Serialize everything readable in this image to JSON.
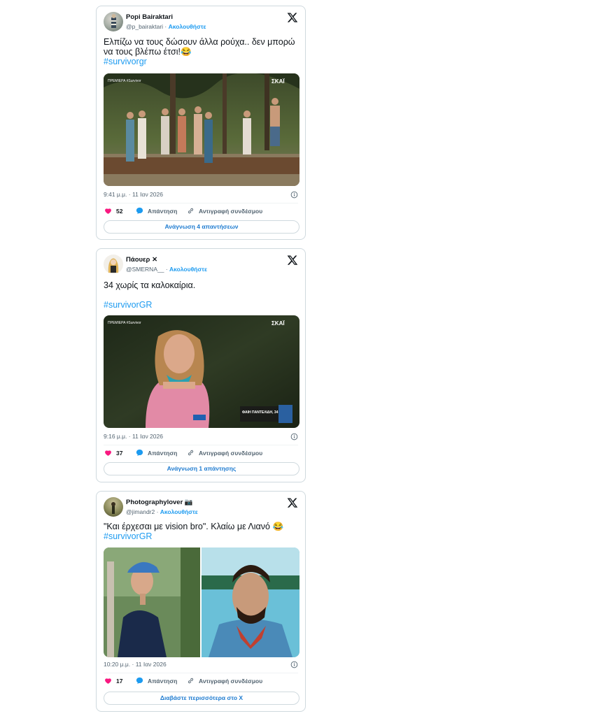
{
  "tweets": [
    {
      "name": "Popi Bairaktari",
      "handle": "@p_bairaktari",
      "follow": "Ακολουθήστε",
      "text_line1": "Ελπίζω να τους δώσουν άλλα ρούχα.. δεν μπορώ",
      "text_line2": "να τους βλέπω έτσι!😂",
      "hashtag": "#survivorgr",
      "media_logo": "ΣΚΑΪ",
      "media_caption": "ΠΡΕΜΙΕΡΑ #Survivor",
      "time": "9:41 μ.μ. · 11 Ιαν 2026",
      "likes": "52",
      "reply": "Απάντηση",
      "copy": "Αντιγραφή συνδέσμου",
      "cta": "Ανάγνωση 4 απαντήσεων"
    },
    {
      "name": "Πάουερ",
      "name_badge": "✕",
      "handle": "@SMERNA__",
      "follow": "Ακολουθήστε",
      "text_line1": "34 χωρίς τα καλοκαίρια.",
      "hashtag": "#survivorGR",
      "media_logo": "ΣΚΑΪ",
      "media_caption": "ΠΡΕΜΙΕΡΑ #Survivor",
      "lower_third": "ΦΑΙΗ ΠΑΝΤΕΛΙΔΗ, 34",
      "time": "9:16 μ.μ. · 11 Ιαν 2026",
      "likes": "37",
      "reply": "Απάντηση",
      "copy": "Αντιγραφή συνδέσμου",
      "cta": "Ανάγνωση 1 απάντησης"
    },
    {
      "name": "Photographylover 📷",
      "handle": "@jimandr2",
      "follow": "Ακολουθήστε",
      "text_line1": "\"Και έρχεσαι με vision bro\". Κλαίω με Λιανό 😂",
      "hashtag": "#survivorGR",
      "time": "10:20 μ.μ. · 11 Ιαν 2026",
      "likes": "17",
      "reply": "Απάντηση",
      "copy": "Αντιγραφή συνδέσμου",
      "cta": "Διαβάστε περισσότερα στο X"
    }
  ],
  "colors": {
    "accent": "#1d9bf0",
    "like": "#f91880",
    "border": "#cfd9de"
  },
  "icons": [
    "x-logo-icon",
    "heart-icon",
    "reply-bubble-icon",
    "link-icon",
    "info-icon"
  ]
}
